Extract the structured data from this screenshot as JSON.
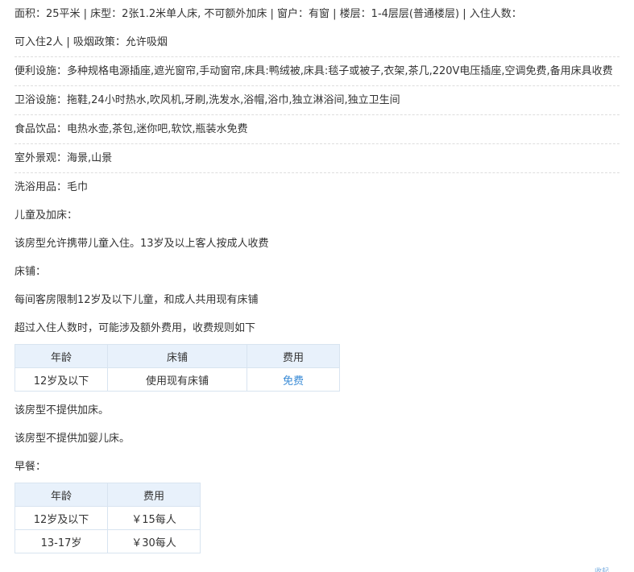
{
  "basic": {
    "line1": "面积：25平米 | 床型：2张1.2米单人床, 不可额外加床 | 窗户：有窗 | 楼层：1-4层层(普通楼层) | 入住人数：",
    "line2": "可入住2人 | 吸烟政策：允许吸烟"
  },
  "facilities": [
    {
      "label": "便利设施：",
      "text": "多种规格电源插座,遮光窗帘,手动窗帘,床具:鸭绒被,床具:毯子或被子,衣架,茶几,220V电压插座,空调免费,备用床具收费"
    },
    {
      "label": "卫浴设施：",
      "text": "拖鞋,24小时热水,吹风机,牙刷,洗发水,浴帽,浴巾,独立淋浴间,独立卫生间"
    },
    {
      "label": "食品饮品：",
      "text": "电热水壶,茶包,迷你吧,软饮,瓶装水免费"
    },
    {
      "label": "室外景观：",
      "text": "海景,山景"
    },
    {
      "label": "洗浴用品：",
      "text": "毛巾"
    }
  ],
  "children": {
    "heading": "儿童及加床：",
    "policy": "该房型允许携带儿童入住。13岁及以上客人按成人收费",
    "bed_heading": "床铺：",
    "bed_limit": "每间客房限制12岁及以下儿童，和成人共用现有床铺",
    "extra_note": "超过入住人数时，可能涉及额外费用，收费规则如下",
    "bed_table": {
      "headers": [
        "年龄",
        "床铺",
        "费用"
      ],
      "rows": [
        [
          "12岁及以下",
          "使用现有床铺",
          "免费"
        ]
      ]
    },
    "no_extra_bed": "该房型不提供加床。",
    "no_crib": "该房型不提供加婴儿床。"
  },
  "breakfast": {
    "heading": "早餐：",
    "table": {
      "headers": [
        "年龄",
        "费用"
      ],
      "rows": [
        [
          "12岁及以下",
          "￥15每人"
        ],
        [
          "13-17岁",
          "￥30每人"
        ]
      ]
    }
  },
  "corner_text": "收起"
}
